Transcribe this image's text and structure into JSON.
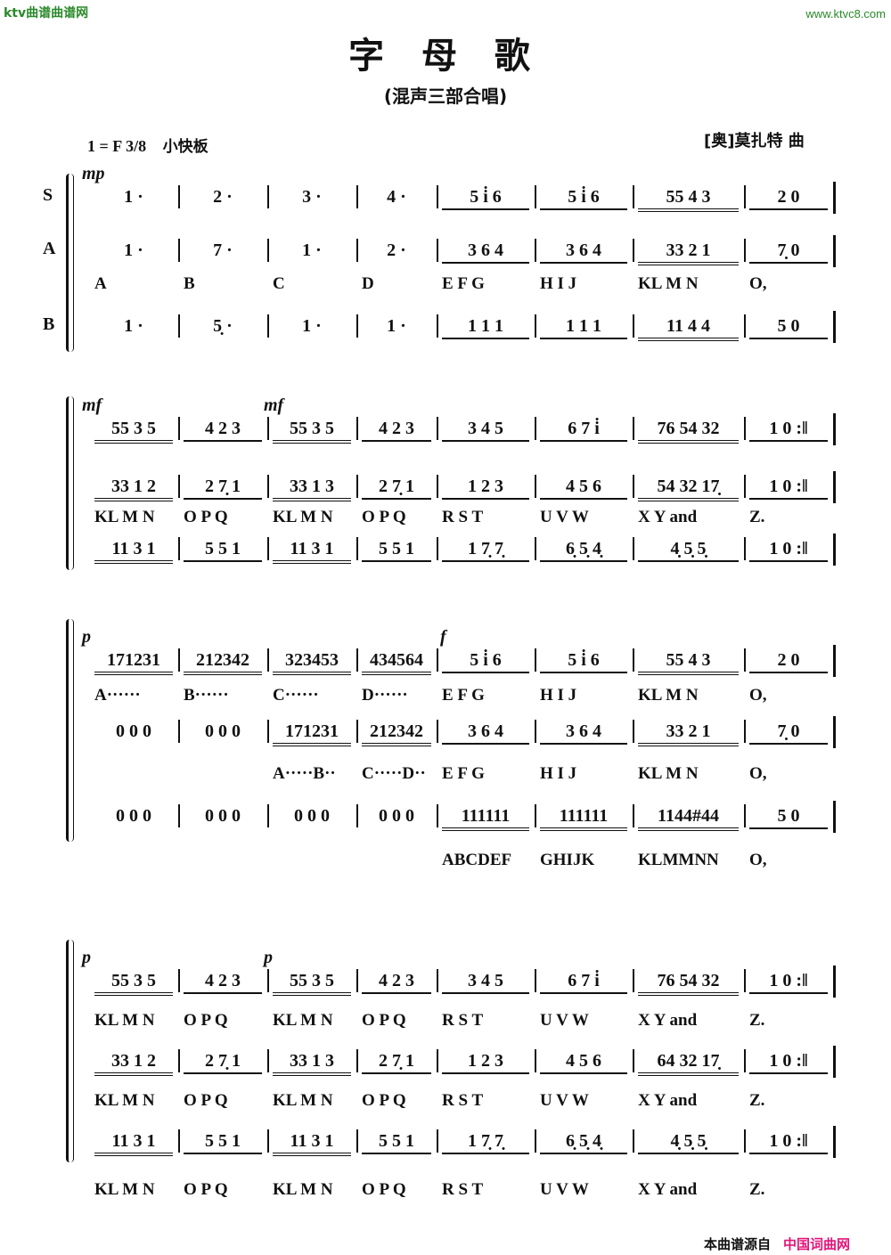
{
  "watermarks": {
    "top_left": "ktv曲谱曲谱网",
    "top_right": "www.ktvc8.com"
  },
  "title": "字 母 歌",
  "subtitle": "(混声三部合唱)",
  "key_signature": "1 = F",
  "time_signature": "3/8",
  "tempo": "小快板",
  "composer": "[奥]莫扎特  曲",
  "footer": {
    "prefix": "本曲谱源自",
    "source": "中国词曲网"
  },
  "voices": {
    "soprano": "S",
    "alto": "A",
    "bass": "B"
  },
  "systems": [
    {
      "dynamics": [
        "mp"
      ],
      "rows": [
        {
          "voice": "S",
          "measures": [
            "1 ·",
            "2 ·",
            "3 ·",
            "4 ·",
            "5 i̇ 6",
            "5 i̇ 6",
            "55 4 3",
            "2 0"
          ]
        },
        {
          "voice": "A",
          "measures": [
            "1 ·",
            "7 ·",
            "1 ·",
            "2 ·",
            "3 6 4",
            "3 6 4",
            "33 2 1",
            "7̣ 0"
          ]
        },
        {
          "voice": "B",
          "measures": [
            "1 ·",
            "5̣ ·",
            "1 ·",
            "1 ·",
            "1 1 1",
            "1 1 1",
            "11 4 4",
            "5 0"
          ]
        }
      ],
      "lyrics": [
        [
          "A",
          "B",
          "C",
          "D",
          "E F G",
          "H I J",
          "KL M N",
          "O,"
        ]
      ]
    },
    {
      "dynamics": [
        "mf",
        "mf"
      ],
      "rows": [
        {
          "voice": "S",
          "measures": [
            "55 3 5",
            "4 2 3",
            "55 3 5",
            "4 2 3",
            "3 4 5",
            "6 7 i̇",
            "76 54 32",
            "1 0 :‖"
          ]
        },
        {
          "voice": "A",
          "measures": [
            "33 1 2",
            "2 7̣ 1",
            "33 1 3",
            "2 7̣ 1",
            "1 2 3",
            "4 5 6",
            "54 32 17̣",
            "1 0 :‖"
          ]
        },
        {
          "voice": "B",
          "measures": [
            "11 3 1",
            "5 5 1",
            "11 3 1",
            "5 5 1",
            "1 7̣ 7̣",
            "6̣ 5̣ 4̣",
            "4̣ 5̣ 5̣",
            "1 0 :‖"
          ]
        }
      ],
      "lyrics": [
        [
          "KL M N",
          "O P Q",
          "KL M N",
          "O P Q",
          "R S T",
          "U V W",
          "X Y and",
          "Z."
        ]
      ]
    },
    {
      "dynamics": [
        "p",
        "f"
      ],
      "rows": [
        {
          "voice": "S",
          "measures": [
            "171231",
            "212342",
            "323453",
            "434564",
            "5 i̇ 6",
            "5 i̇ 6",
            "55 4 3",
            "2 0"
          ]
        },
        {
          "voice": "A",
          "measures": [
            "0 0 0",
            "0 0 0",
            "171231",
            "212342",
            "3 6 4",
            "3 6 4",
            "33 2 1",
            "7̣ 0"
          ]
        },
        {
          "voice": "B",
          "measures": [
            "0 0 0",
            "0 0 0",
            "0 0 0",
            "0 0 0",
            "111111",
            "111111",
            "1144#44",
            "5 0"
          ]
        }
      ],
      "lyrics": [
        [
          "A······",
          "B······",
          "C······",
          "D······",
          "E F G",
          "H I J",
          "KL M N",
          "O,"
        ],
        [
          "",
          "",
          "A·····B··",
          "C·····D··",
          "E F G",
          "H I J",
          "KL M N",
          "O,"
        ],
        [
          "",
          "",
          "",
          "",
          "ABCDEF",
          "GHIJK",
          "KLMMNN",
          "O,"
        ]
      ]
    },
    {
      "dynamics": [
        "p",
        "p"
      ],
      "rows": [
        {
          "voice": "S",
          "measures": [
            "55 3 5",
            "4 2 3",
            "55 3 5",
            "4 2 3",
            "3 4 5",
            "6 7 i̇",
            "76 54 32",
            "1 0 :‖"
          ]
        },
        {
          "voice": "A",
          "measures": [
            "33 1 2",
            "2 7̣ 1",
            "33 1 3",
            "2 7̣ 1",
            "1 2 3",
            "4 5 6",
            "64 32 17̣",
            "1 0 :‖"
          ]
        },
        {
          "voice": "B",
          "measures": [
            "11 3 1",
            "5 5 1",
            "11 3 1",
            "5 5 1",
            "1 7̣ 7̣",
            "6̣ 5̣ 4̣",
            "4̣ 5̣ 5̣",
            "1 0 :‖"
          ]
        }
      ],
      "lyrics": [
        [
          "KL M N",
          "O P Q",
          "KL M N",
          "O P Q",
          "R S T",
          "U V W",
          "X Y and",
          "Z."
        ],
        [
          "KL M N",
          "O P Q",
          "KL M N",
          "O P Q",
          "R S T",
          "U V W",
          "X Y and",
          "Z."
        ],
        [
          "KL M N",
          "O P Q",
          "KL M N",
          "O P Q",
          "R S T",
          "U V W",
          "X Y and",
          "Z."
        ]
      ]
    }
  ]
}
